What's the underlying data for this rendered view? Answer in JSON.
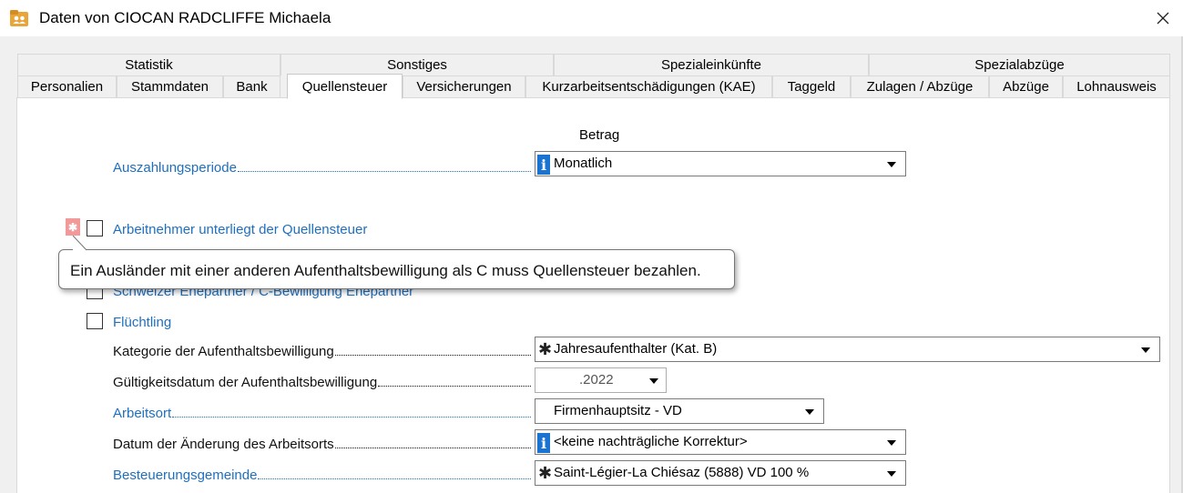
{
  "window": {
    "title": "Daten von CIOCAN RADCLIFFE Michaela",
    "icon": "contacts-folder-icon"
  },
  "tabs_top": [
    "Statistik",
    "Sonstiges",
    "Spezialeinkünfte",
    "Spezialabzüge"
  ],
  "tabs_bottom": [
    "Personalien",
    "Stammdaten",
    "Bank",
    "Quellensteuer",
    "Versicherungen",
    "Kurzarbeitsentschädigungen (KAE)",
    "Taggeld",
    "Zulagen / Abzüge",
    "Abzüge",
    "Lohnausweis"
  ],
  "active_tab": "Quellensteuer",
  "form": {
    "column_heading": "Betrag",
    "auszahlungsperiode": {
      "label": "Auszahlungsperiode",
      "value": "Monatlich",
      "icon": "info-icon"
    },
    "unterliegt_qst": {
      "label": "Arbeitnehmer unterliegt der Quellensteuer",
      "checked": false
    },
    "ehepartner": {
      "label": "Schweizer Ehepartner / C-Bewilligung Ehepartner",
      "checked": false
    },
    "fluechtling": {
      "label": "Flüchtling",
      "checked": false
    },
    "kategorie": {
      "label": "Kategorie der Aufenthaltsbewilligung",
      "value": "Jahresaufenthalter (Kat. B)",
      "icon": "asterisk-icon"
    },
    "gueltigkeit": {
      "label": "Gültigkeitsdatum der Aufenthaltsbewilligung",
      "value": ".2022"
    },
    "arbeitsort": {
      "label": "Arbeitsort",
      "value": "Firmenhauptsitz - VD"
    },
    "datum_aenderung": {
      "label": "Datum der Änderung des Arbeitsorts",
      "value": "<keine nachträgliche Korrektur>",
      "icon": "info-icon"
    },
    "besteuerungsgemeinde": {
      "label": "Besteuerungsgemeinde",
      "value": "Saint-Légier-La Chiésaz (5888) VD 100 %",
      "icon": "asterisk-icon"
    }
  },
  "tooltip": {
    "text": "Ein Ausländer mit einer anderen Aufenthaltsbewilligung als C muss Quellensteuer bezahlen."
  },
  "colors": {
    "link_blue": "#1d6fc1",
    "info_blue": "#1a73d1",
    "required_red": "#f29a9a"
  }
}
